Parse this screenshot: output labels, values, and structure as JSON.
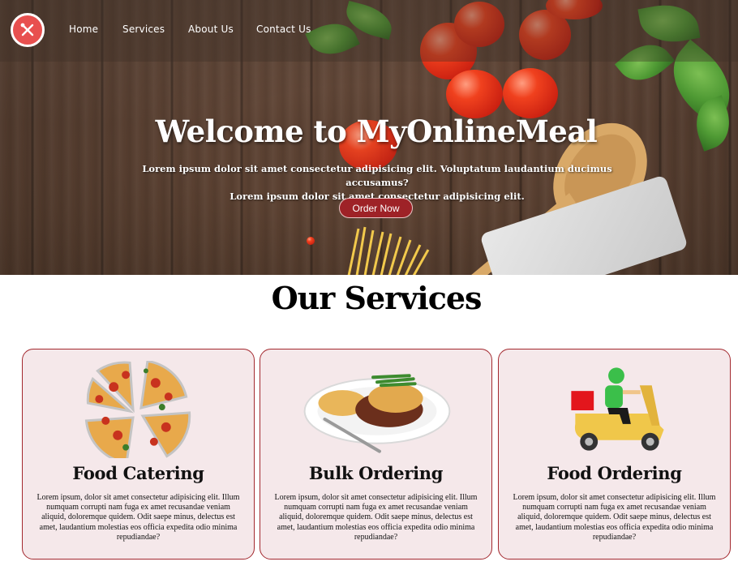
{
  "nav": {
    "logo_icon": "fork-knife-icon",
    "links": [
      "Home",
      "Services",
      "About Us",
      "Contact Us"
    ]
  },
  "hero": {
    "title": "Welcome to MyOnlineMeal",
    "subtitle_line1": "Lorem ipsum dolor sit amet consectetur adipisicing elit. Voluptatum laudantium ducimus accusamus?",
    "subtitle_line2": "Lorem ipsum dolor sit amet consectetur adipisicing elit.",
    "cta_label": "Order Now"
  },
  "services": {
    "title": "Our Services",
    "cards": [
      {
        "title": "Food Catering",
        "icon": "pizza-icon",
        "text": "Lorem ipsum, dolor sit amet consectetur adipisicing elit. Illum numquam corrupti nam fuga ex amet recusandae veniam aliquid, doloremque quidem. Odit saepe minus, delectus est amet, laudantium molestias eos officia expedita odio minima repudiandae?"
      },
      {
        "title": "Bulk Ordering",
        "icon": "meal-plate-icon",
        "text": "Lorem ipsum, dolor sit amet consectetur adipisicing elit. Illum numquam corrupti nam fuga ex amet recusandae veniam aliquid, doloremque quidem. Odit saepe minus, delectus est amet, laudantium molestias eos officia expedita odio minima repudiandae?"
      },
      {
        "title": "Food Ordering",
        "icon": "delivery-scooter-icon",
        "text": "Lorem ipsum, dolor sit amet consectetur adipisicing elit. Illum numquam corrupti nam fuga ex amet recusandae veniam aliquid, doloremque quidem. Odit saepe minus, delectus est amet, laudantium molestias eos officia expedita odio minima repudiandae?"
      }
    ]
  },
  "colors": {
    "accent": "#9e2227",
    "card_background": "#f5e8ea",
    "card_border": "#a3282e",
    "logo_background": "#e8504f"
  }
}
